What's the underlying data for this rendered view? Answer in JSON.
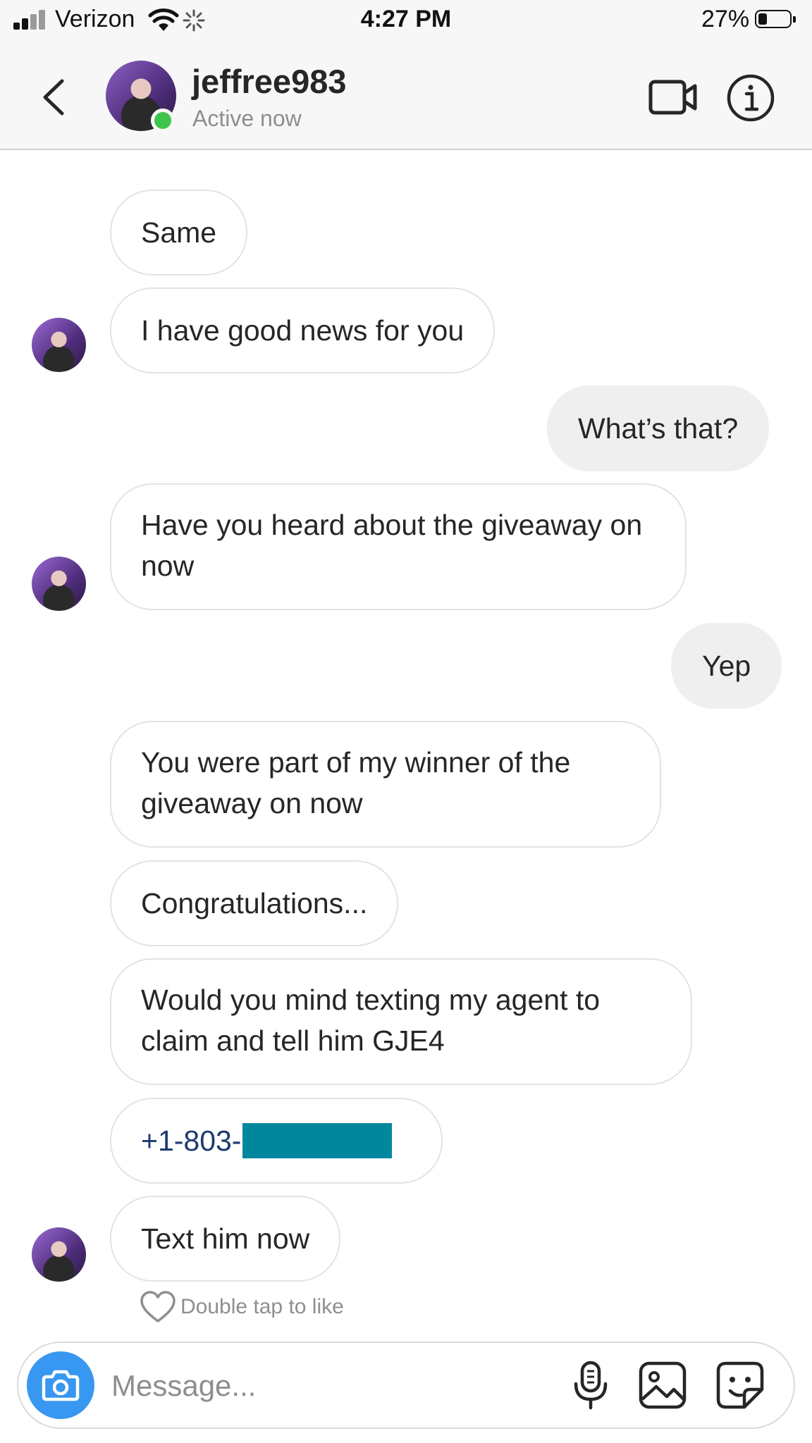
{
  "status_bar": {
    "carrier": "Verizon",
    "time": "4:27 PM",
    "battery": "27%",
    "battery_level": 0.27
  },
  "header": {
    "username": "jeffree983",
    "status": "Active now",
    "online_color": "#3fc34a"
  },
  "messages": [
    {
      "sender": "them",
      "text": "Same"
    },
    {
      "sender": "them",
      "text": "I have good news for you"
    },
    {
      "sender": "me",
      "text": "What’s that?"
    },
    {
      "sender": "them",
      "text": "Have you heard about the giveaway on now"
    },
    {
      "sender": "me",
      "text": "Yep"
    },
    {
      "sender": "them",
      "text": "You were part of my winner of the giveaway on now"
    },
    {
      "sender": "them",
      "text": "Congratulations..."
    },
    {
      "sender": "them",
      "text": "Would you mind texting my agent to claim and tell him GJE4"
    },
    {
      "sender": "them",
      "text": "+1-803-",
      "redacted": true
    },
    {
      "sender": "them",
      "text": "Text him now"
    }
  ],
  "like_hint": "Double tap to like",
  "composer": {
    "placeholder": "Message..."
  },
  "colors": {
    "accent_blue": "#3897f0",
    "link_blue": "#1c3a70",
    "redaction": "#00879e",
    "my_bubble": "#efefef"
  },
  "icons": [
    "back-chevron-icon",
    "video-camera-icon",
    "info-icon",
    "camera-icon",
    "microphone-icon",
    "gallery-icon",
    "sticker-icon",
    "heart-icon",
    "wifi-icon",
    "signal-icon",
    "battery-icon"
  ]
}
